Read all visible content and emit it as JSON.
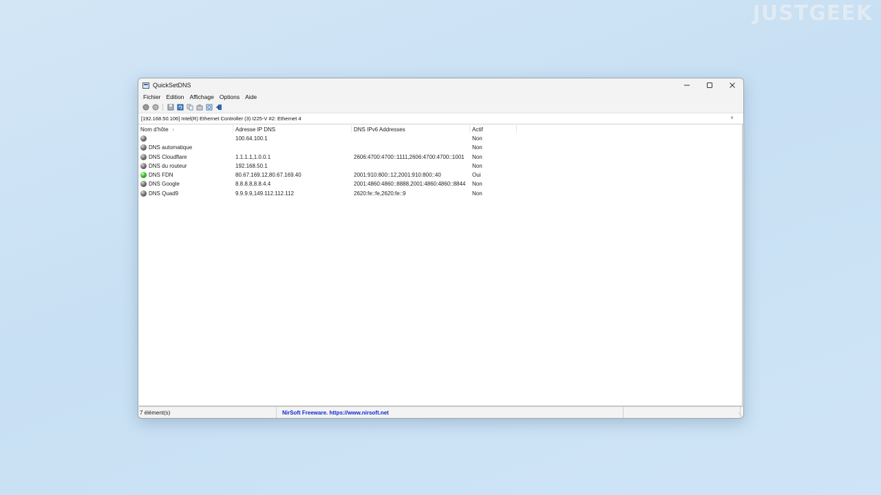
{
  "watermark": "JUSTGEEK",
  "window": {
    "title": "QuickSetDNS",
    "controls": {
      "minimize": "—",
      "maximize": "☐",
      "close": "✕"
    }
  },
  "menu": [
    "Fichier",
    "Edition",
    "Affichage",
    "Options",
    "Aide"
  ],
  "toolbar": {
    "icons": [
      "enable-icon",
      "disable-icon",
      "save-icon",
      "refresh-icon",
      "copy-icon",
      "properties-icon",
      "html-report-icon",
      "exit-icon"
    ]
  },
  "adapter": {
    "text": "[192.168.50.106]  Intel(R) Ethernet Controller (3) I225-V #2: Ethernet 4"
  },
  "list": {
    "headers": [
      "Nom d'hôte",
      "Adresse IP DNS",
      "DNS IPv6 Addresses",
      "Actif"
    ],
    "sort_indicator": "/",
    "rows": [
      {
        "name": "",
        "ip": "100.64.100.1",
        "ipv6": "",
        "active": "Non",
        "status": "gray"
      },
      {
        "name": "DNS automatique",
        "ip": "",
        "ipv6": "",
        "active": "Non",
        "status": "gray"
      },
      {
        "name": "DNS Cloudflare",
        "ip": "1.1.1.1,1.0.0.1",
        "ipv6": "2606:4700:4700::1111,2606:4700:4700::1001",
        "active": "Non",
        "status": "gray"
      },
      {
        "name": "DNS du routeur",
        "ip": "192.168.50.1",
        "ipv6": "",
        "active": "Non",
        "status": "gray"
      },
      {
        "name": "DNS FDN",
        "ip": "80.67.169.12,80.67.169.40",
        "ipv6": "2001:910:800::12,2001:910:800::40",
        "active": "Oui",
        "status": "green"
      },
      {
        "name": "DNS Google",
        "ip": "8.8.8.8,8.8.4.4",
        "ipv6": "2001:4860:4860::8888,2001:4860:4860::8844",
        "active": "Non",
        "status": "gray"
      },
      {
        "name": "DNS Quad9",
        "ip": "9.9.9.9,149.112.112.112",
        "ipv6": "2620:fe::fe,2620:fe::9",
        "active": "Non",
        "status": "gray"
      }
    ]
  },
  "status": {
    "count": "7 élément(s)",
    "link": "NirSoft Freeware. https://www.nirsoft.net"
  },
  "colors": {
    "accent_link": "#0a2ad0",
    "active_dot": "#39c02a",
    "inactive_dot": "#7a7a7a"
  }
}
